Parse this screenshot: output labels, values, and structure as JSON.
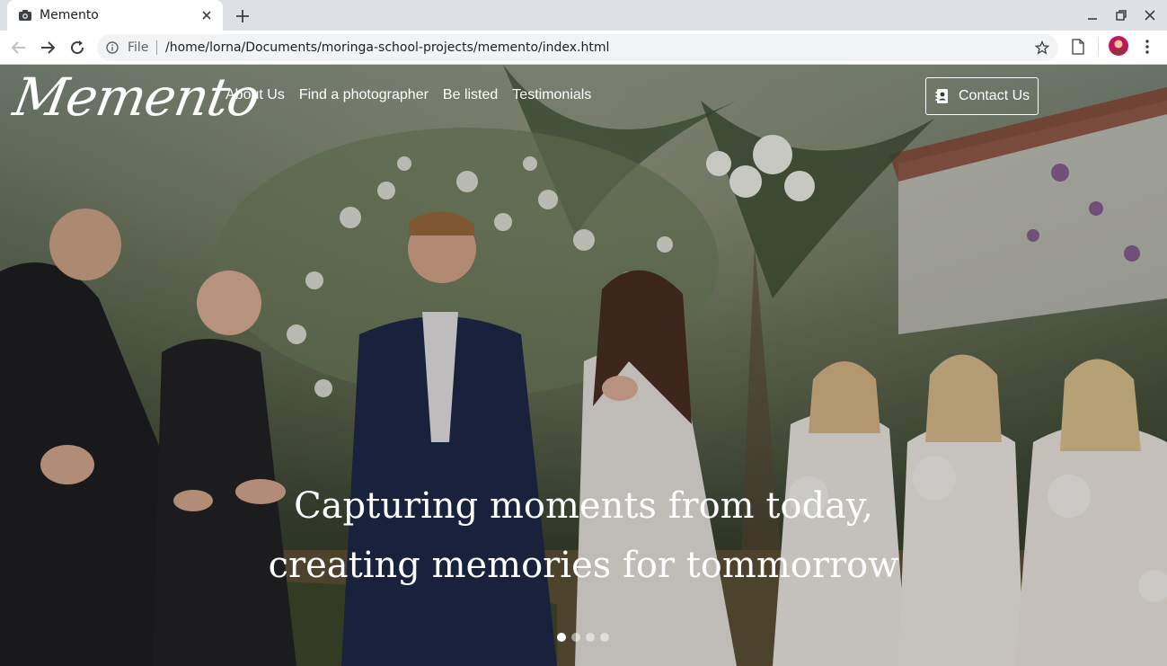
{
  "browser": {
    "tab_title": "Memento",
    "scheme_label": "File",
    "url": "/home/lorna/Documents/moringa-school-projects/memento/index.html"
  },
  "site": {
    "brand": "Memento",
    "nav": [
      "About Us",
      "Find a photographer",
      "Be listed",
      "Testimonials"
    ],
    "contact_label": "Contact Us",
    "headline_line1": "Capturing moments from today,",
    "headline_line2": "creating memories for tommorrow",
    "carousel": {
      "slides": 4,
      "active": 1
    }
  }
}
